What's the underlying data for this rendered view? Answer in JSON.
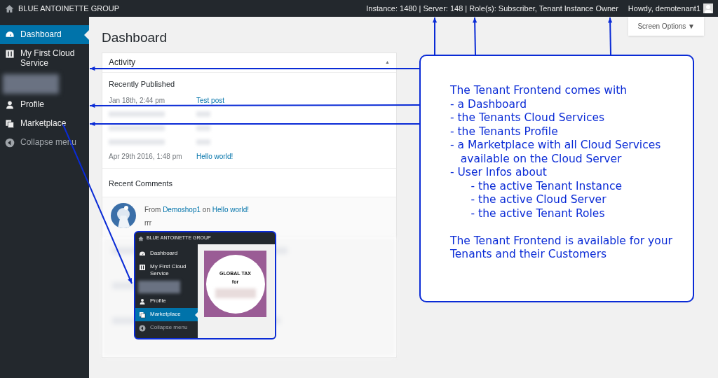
{
  "top_bar": {
    "site_title": "BLUE ANTOINETTE GROUP",
    "info": "Instance: 1480 | Server: 148 | Role(s): Subscriber, Tenant Instance Owner",
    "greeting": "Howdy, demotenant1"
  },
  "sidebar": {
    "items": [
      {
        "kind": "item",
        "label": "Dashboard",
        "selected": true
      },
      {
        "kind": "item",
        "label": "My First Cloud Service",
        "selected": false
      },
      {
        "kind": "blurred"
      },
      {
        "kind": "item",
        "label": "Profile",
        "selected": false
      },
      {
        "kind": "item",
        "label": "Marketplace",
        "selected": false
      },
      {
        "kind": "collapse",
        "label": "Collapse menu"
      }
    ]
  },
  "page": {
    "title": "Dashboard",
    "screen_options": "Screen Options ▼"
  },
  "activity": {
    "title": "Activity",
    "toggle": "▲",
    "recently_published": {
      "heading": "Recently Published",
      "posts": [
        {
          "kind": "post",
          "date": "Jan 18th, 2:44 pm",
          "title": "Test post"
        },
        {
          "kind": "blurred"
        },
        {
          "kind": "blurred"
        },
        {
          "kind": "blurred"
        },
        {
          "kind": "post",
          "date": "Apr 29th 2016, 1:48 pm",
          "title": "Hello world!"
        }
      ]
    },
    "recent_comments": {
      "heading": "Recent Comments",
      "comments": [
        {
          "from": "From",
          "author": "Demoshop1",
          "on": "on",
          "post": "Hello world!",
          "text": "rrr"
        }
      ]
    }
  },
  "annotation": {
    "paragraphs": [
      {
        "lines": [
          "The Tenant Frontend comes with",
          "- a Dashboard",
          "- the Tenants Cloud Services",
          "- the Tenants Profile",
          "- a Marketplace with all Cloud Services",
          "   available on the Cloud Server",
          "- User Infos about",
          "      - the active Tenant Instance",
          "      - the active Cloud Server",
          "      - the active Tenant Roles"
        ]
      },
      {
        "lines": [
          "The Tenant Frontend is available for your",
          "Tenants and their Customers"
        ]
      }
    ]
  },
  "inset": {
    "site_title": "BLUE ANTOINETTE GROUP",
    "items": [
      {
        "kind": "item",
        "label": "Dashboard",
        "selected": false
      },
      {
        "kind": "item",
        "label": "My First Cloud Service",
        "selected": false
      },
      {
        "kind": "blurred"
      },
      {
        "kind": "item",
        "label": "Profile",
        "selected": false
      },
      {
        "kind": "item",
        "label": "Marketplace",
        "selected": true
      },
      {
        "kind": "collapse",
        "label": "Collapse menu"
      }
    ],
    "product": {
      "title": "GLOBAL TAX",
      "subtitle": "for"
    }
  }
}
